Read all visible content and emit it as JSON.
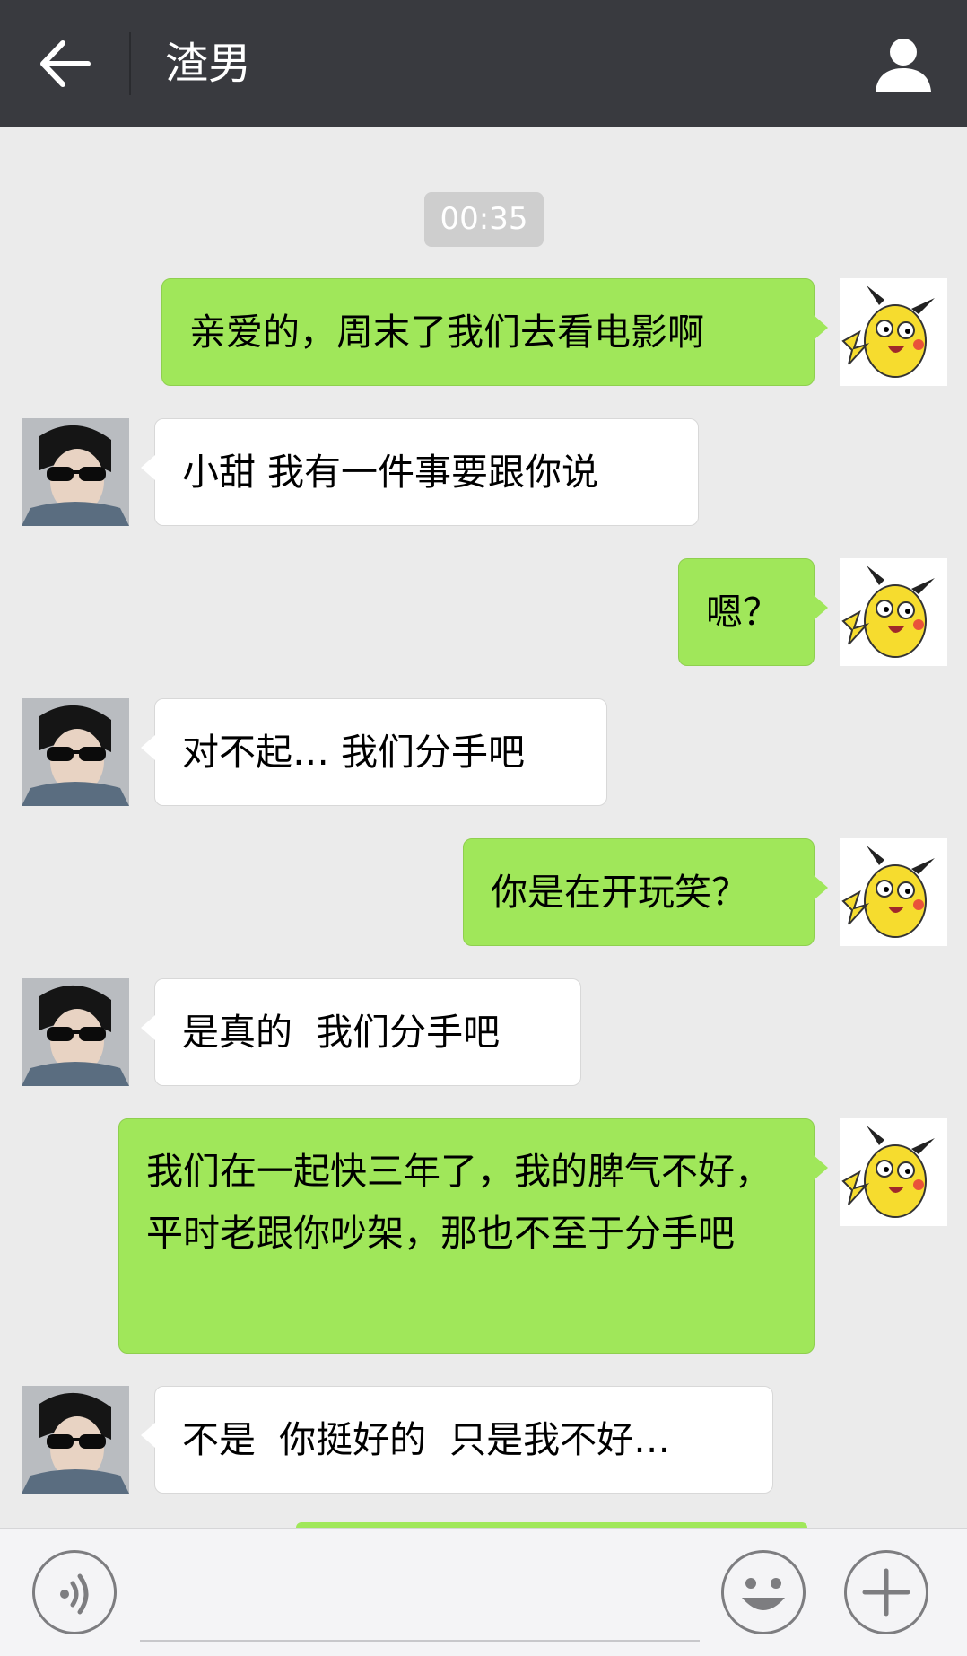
{
  "header": {
    "title": "渣男"
  },
  "chat": {
    "timestamp": "00:35",
    "messages": [
      {
        "side": "right",
        "text": "亲爱的，周末了我们去看电影啊"
      },
      {
        "side": "left",
        "text": "小甜 我有一件事要跟你说"
      },
      {
        "side": "right",
        "text": "嗯？"
      },
      {
        "side": "left",
        "text": "对不起… 我们分手吧"
      },
      {
        "side": "right",
        "text": "你是在开玩笑？"
      },
      {
        "side": "left",
        "text": "是真的  我们分手吧"
      },
      {
        "side": "right",
        "text": "我们在一起快三年了，我的脾气不好，平时老跟你吵架，那也不至于分手吧"
      },
      {
        "side": "left",
        "text": "不是  你挺好的  只是我不好…"
      }
    ]
  },
  "icons": {
    "back": "arrow-left-icon",
    "profile": "person-icon",
    "voice": "voice-icon",
    "emoji": "emoji-icon",
    "plus": "plus-icon"
  },
  "colors": {
    "header_bg": "#393a3f",
    "chat_bg": "#ebebeb",
    "sent_bubble": "#a0e75a",
    "received_bubble": "#ffffff"
  }
}
